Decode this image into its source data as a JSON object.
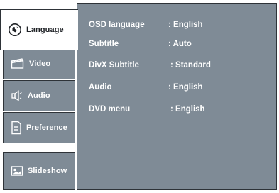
{
  "sidebar": {
    "tabs": [
      {
        "label": "Language",
        "icon": "globe-icon",
        "active": true
      },
      {
        "label": "Video",
        "icon": "video-icon",
        "active": false
      },
      {
        "label": "Audio",
        "icon": "speaker-icon",
        "active": false
      },
      {
        "label": "Preference",
        "icon": "document-icon",
        "active": false
      },
      {
        "label": "Slideshow",
        "icon": "photo-icon",
        "active": false
      }
    ]
  },
  "settings": {
    "rows": [
      {
        "key": "OSD language",
        "value": ": English"
      },
      {
        "key": "Subtitle",
        "value": ": Auto"
      },
      {
        "key": "DivX Subtitle",
        "value": ": Standard"
      },
      {
        "key": "Audio",
        "value": ": English"
      },
      {
        "key": "DVD menu",
        "value": ": English"
      }
    ]
  },
  "colors": {
    "panel": "#7f8b96",
    "active_tab": "#ffffff",
    "border": "#2e3338",
    "text": "#ffffff"
  }
}
